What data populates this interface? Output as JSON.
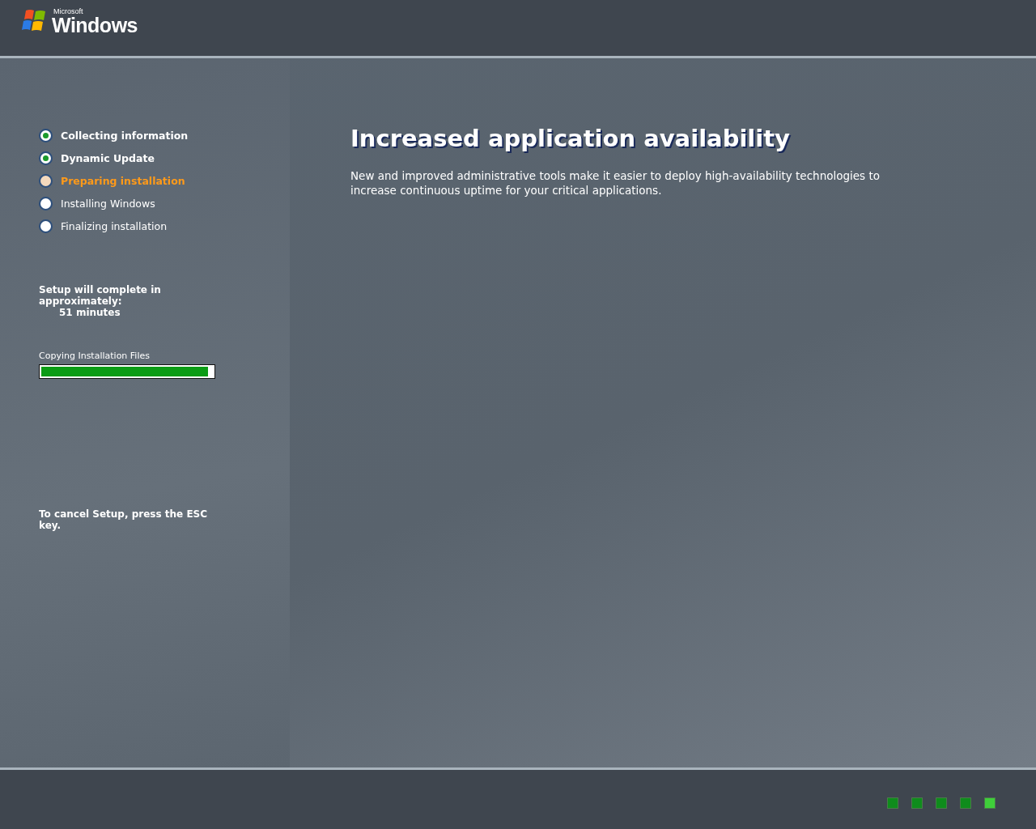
{
  "logo": {
    "maker": "Microsoft",
    "product": "Windows"
  },
  "steps": [
    {
      "label": "Collecting information",
      "done": true,
      "selected": false
    },
    {
      "label": "Dynamic Update",
      "done": true,
      "selected": false
    },
    {
      "label": "Preparing installation",
      "done": false,
      "selected": true
    },
    {
      "label": "Installing Windows",
      "done": false,
      "selected": false
    },
    {
      "label": "Finalizing installation",
      "done": false,
      "selected": false
    }
  ],
  "estimate": {
    "text": "Setup will complete in approximately:",
    "time": "51 minutes"
  },
  "progress": {
    "label": "Copying Installation Files",
    "level": 0.97
  },
  "cancel_hint": "To cancel Setup, press the ESC key.",
  "feature": {
    "title": "Increased application availability",
    "body": "New and improved administrative tools make it easier to deploy high-availability technologies to increase continuous uptime for your critical applications."
  },
  "activity_lights": [
    {
      "selected": false
    },
    {
      "selected": false
    },
    {
      "selected": false
    },
    {
      "selected": false
    },
    {
      "selected": true
    }
  ]
}
